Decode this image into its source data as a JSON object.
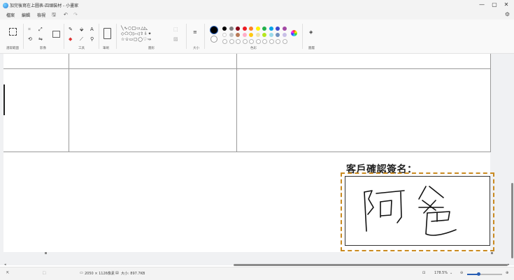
{
  "window": {
    "title": "加完後寫在上圖表-四頭裝材 - 小畫家",
    "minimize": "—",
    "maximize": "▢",
    "close": "✕"
  },
  "menu": {
    "items": [
      "檔案",
      "編輯",
      "檢視"
    ],
    "quick_icons": [
      "save-icon",
      "undo-icon",
      "redo-icon",
      "settings-icon"
    ],
    "save": "🖫",
    "undo": "↶",
    "redo": "↷",
    "settings": "⚙"
  },
  "ribbon": {
    "groups": [
      "選取範圍",
      "影像",
      "工具",
      "筆刷",
      "圖形",
      "大小",
      "色彩",
      "圖層"
    ],
    "shapes_row1": "╲∿○□▭△◺",
    "shapes_row2": "◇⬠⬡▷◁⇧⇩✦",
    "shapes_row3": "☆✩▭▢◯♡↝",
    "colors_row1": [
      "#000000",
      "#7f7f7f",
      "#880015",
      "#ed1c24",
      "#ff7f27",
      "#fff200",
      "#22b14c",
      "#00a2e8",
      "#3f48cc",
      "#a349a4"
    ],
    "colors_row2": [
      "#ffffff",
      "#c3c3c3",
      "#b97a57",
      "#ffaec9",
      "#ffc90e",
      "#efe4b0",
      "#b5e61d",
      "#99d9ea",
      "#7092be",
      "#c8bfe7"
    ],
    "accent": "#c98a20"
  },
  "canvas": {
    "signature_label": "客戶確認簽名：",
    "signature_text": "阿爸"
  },
  "status": {
    "dimensions": "2050 × 1126像素",
    "size": "大小: 897.7KB",
    "zoom": "178.5%"
  }
}
